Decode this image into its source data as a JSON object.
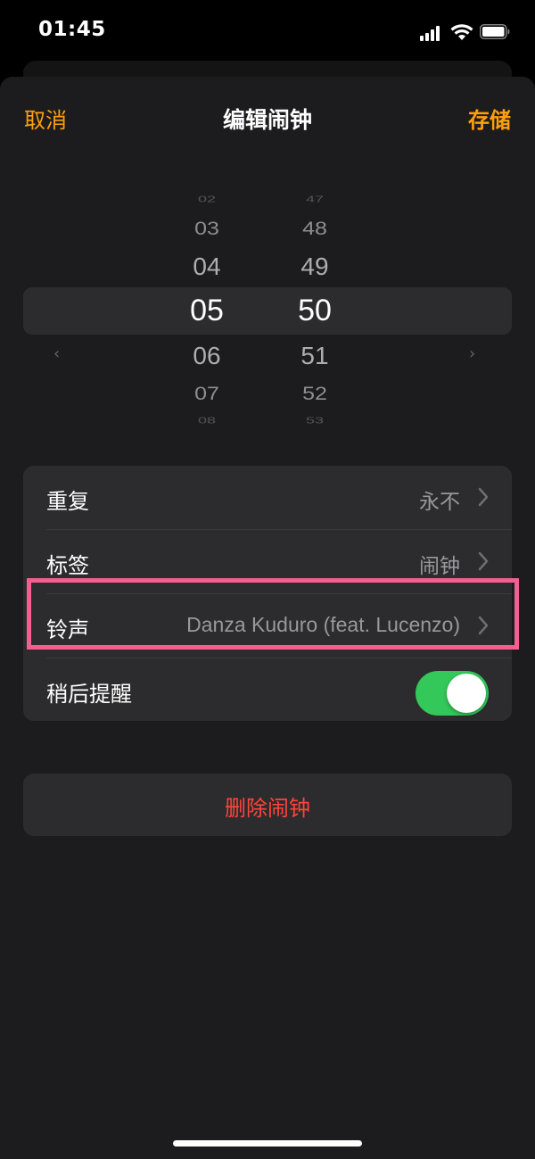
{
  "status_bar": {
    "time": "01:45"
  },
  "nav": {
    "cancel_label": "取消",
    "title": "编辑闹钟",
    "save_label": "存储"
  },
  "picker": {
    "hours": [
      "02",
      "03",
      "04",
      "05",
      "06",
      "07",
      "08"
    ],
    "minutes": [
      "47",
      "48",
      "49",
      "50",
      "51",
      "52",
      "53"
    ],
    "selected_hour": "05",
    "selected_minute": "50"
  },
  "settings": {
    "repeat": {
      "label": "重复",
      "value": "永不"
    },
    "tag": {
      "label": "标签",
      "value": "闹钟"
    },
    "sound": {
      "label": "铃声",
      "value": "Danza Kuduro (feat. Lucenzo)"
    },
    "snooze": {
      "label": "稍后提醒",
      "enabled": true
    }
  },
  "delete_label": "删除闹钟",
  "colors": {
    "accent": "#ff9f0a",
    "destructive": "#ff453a",
    "toggle_on": "#34c759",
    "annotation": "#f2608f"
  }
}
